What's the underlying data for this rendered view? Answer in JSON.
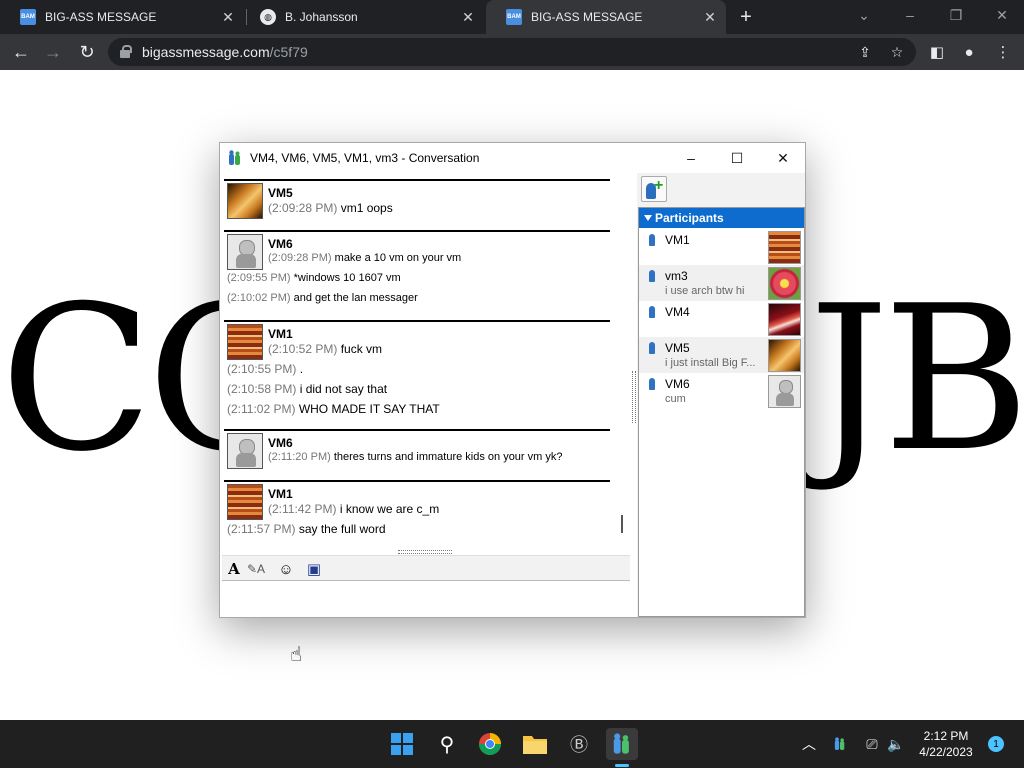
{
  "browser": {
    "tabs": [
      {
        "title": "BIG-ASS MESSAGE",
        "favicon": "BAM"
      },
      {
        "title": "B. Johansson",
        "favicon": ""
      },
      {
        "title": "BIG-ASS MESSAGE",
        "favicon": "BAM"
      }
    ],
    "url_host": "bigassmessage.com",
    "url_path": "/c5f79",
    "icons": [
      "back-icon",
      "forward-icon",
      "reload-icon",
      "lock-icon",
      "share-icon",
      "star-icon",
      "sidepanel-icon",
      "profile-icon",
      "menu-icon"
    ]
  },
  "page": {
    "big_left": "CO",
    "big_right": "JB"
  },
  "conversation": {
    "title": "VM4, VM6, VM5, VM1, vm3 - Conversation",
    "messages": [
      {
        "sender": "VM5",
        "avatar": "orange",
        "lines": [
          {
            "ts": "(2:09:28 PM)",
            "text": " vm1 oops"
          }
        ]
      },
      {
        "sender": "VM6",
        "avatar": "robot",
        "lines": [
          {
            "ts": "(2:09:28 PM)",
            "text": " make a 10 vm on your vm"
          },
          {
            "ts": "(2:09:55 PM)",
            "text": " *windows 10 1607 vm"
          },
          {
            "ts": "(2:10:02 PM)",
            "text": " and get the lan messager"
          }
        ]
      },
      {
        "sender": "VM1",
        "avatar": "books",
        "lines": [
          {
            "ts": "(2:10:52 PM)",
            "text": " fuck vm"
          },
          {
            "ts": "(2:10:55 PM)",
            "text": " ."
          },
          {
            "ts": "(2:10:58 PM)",
            "text": " i did not say that"
          },
          {
            "ts": "(2:11:02 PM)",
            "text": " WHO MADE IT SAY THAT"
          }
        ]
      },
      {
        "sender": "VM6",
        "avatar": "robot",
        "lines": [
          {
            "ts": "(2:11:20 PM)",
            "text": " theres turns and immature kids on your vm yk?"
          }
        ]
      },
      {
        "sender": "VM1",
        "avatar": "books",
        "lines": [
          {
            "ts": "(2:11:42 PM)",
            "text": " i know we are c_m"
          },
          {
            "ts": "(2:11:57 PM)",
            "text": " say the full word"
          }
        ]
      }
    ],
    "input_value": "",
    "participants_label": "Participants",
    "participants": [
      {
        "name": "VM1",
        "status": "",
        "avatar": "books"
      },
      {
        "name": "vm3",
        "status": "i use arch btw hi",
        "avatar": "flower"
      },
      {
        "name": "VM4",
        "status": "",
        "avatar": "crane"
      },
      {
        "name": "VM5",
        "status": "i just install Big F...",
        "avatar": "orange"
      },
      {
        "name": "VM6",
        "status": "cum",
        "avatar": "robot"
      }
    ]
  },
  "taskbar": {
    "time": "2:12 PM",
    "date": "4/22/2023",
    "notifications": "1",
    "accent": "#4cc2ff"
  }
}
